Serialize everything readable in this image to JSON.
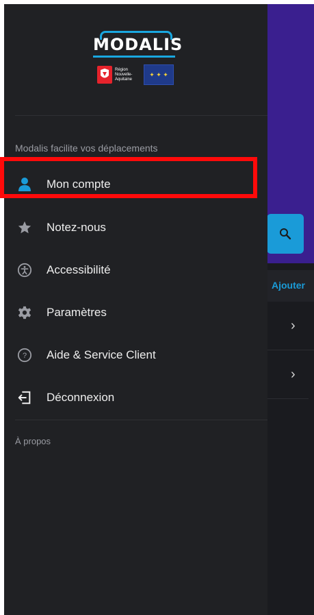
{
  "background": {
    "add_label": "Ajouter",
    "rows": [
      {
        "chevron": "›"
      },
      {
        "chevron": "›"
      }
    ]
  },
  "drawer": {
    "logo": "MODALIS",
    "region_text": "Région Nouvelle-Aquitaine",
    "tagline": "Modalis facilite vos déplacements",
    "items": [
      {
        "label": "Mon compte",
        "icon": "person-icon",
        "color": "#1a9bd8"
      },
      {
        "label": "Notez-nous",
        "icon": "star-icon"
      },
      {
        "label": "Accessibilité",
        "icon": "accessibility-icon"
      },
      {
        "label": "Paramètres",
        "icon": "gear-icon"
      },
      {
        "label": "Aide & Service Client",
        "icon": "help-icon"
      },
      {
        "label": "Déconnexion",
        "icon": "logout-icon"
      }
    ],
    "about": "À propos"
  },
  "colors": {
    "accent": "#1a9bd8",
    "highlight": "#ff0a0a",
    "drawer_bg": "#202124",
    "header_purple": "#3a1f8f"
  }
}
